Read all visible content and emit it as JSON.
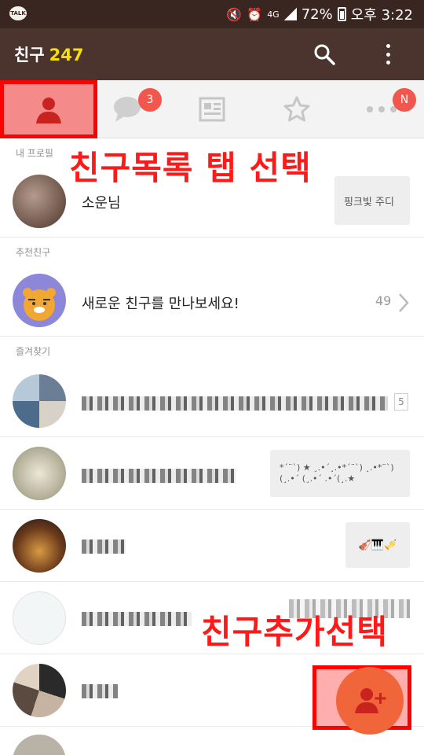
{
  "status_bar": {
    "app_icon": "TALK",
    "battery": "72%",
    "time": "오후 3:22",
    "network": "4G"
  },
  "header": {
    "title": "친구",
    "count": "247"
  },
  "tabs": {
    "chat_badge": "3",
    "more_badge": "N"
  },
  "sections": {
    "my_profile": "내 프로필",
    "recommended": "추천친구",
    "favorites": "즐겨찾기"
  },
  "my_profile": {
    "name": "소운님",
    "status": "핑크빛 주디"
  },
  "recommended": {
    "text": "새로운 친구를 만나보세요!",
    "count": "49"
  },
  "favorites": [
    {
      "badge": "5",
      "status": ""
    },
    {
      "status": "*´¨`) ★ ¸.•´¸.•*´¨`) ¸.•*¨`)(¸.•´ (¸.•´ .•´(¸.★"
    },
    {
      "status": "🎻🎹🎺"
    }
  ],
  "annotations": {
    "select_tab": "친구목록 탭 선택",
    "add_friend": "친구추가선택"
  },
  "colors": {
    "header_bg": "#4a342d",
    "count": "#f9e000",
    "badge": "#f2574d",
    "fab": "#f0663a",
    "annotation": "#ff1a1a"
  }
}
